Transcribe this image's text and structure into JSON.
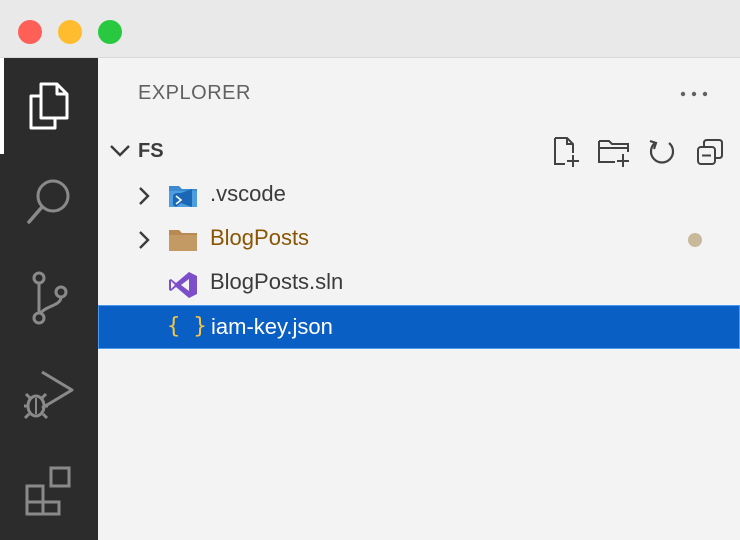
{
  "sidebar": {
    "title": "EXPLORER",
    "more_label": "···",
    "section": {
      "label": "FS"
    },
    "items": [
      {
        "label": ".vscode",
        "type": "folder",
        "expandable": true,
        "icon": "vscode-folder-icon"
      },
      {
        "label": "BlogPosts",
        "type": "folder",
        "expandable": true,
        "icon": "folder-icon",
        "modified": true
      },
      {
        "label": "BlogPosts.sln",
        "type": "file",
        "expandable": false,
        "icon": "visual-studio-icon"
      },
      {
        "label": "iam-key.json",
        "type": "file",
        "expandable": false,
        "icon": "json-icon",
        "selected": true,
        "icon_glyph": "{ }"
      }
    ]
  },
  "activitybar": {
    "items": [
      "explorer-icon",
      "search-icon",
      "source-control-icon",
      "run-debug-icon",
      "extensions-icon"
    ]
  },
  "colors": {
    "selection": "#0a5fc4",
    "modified_text": "#895503",
    "activity_bar": "#2c2c2c",
    "sidebar": "#f3f3f3"
  }
}
